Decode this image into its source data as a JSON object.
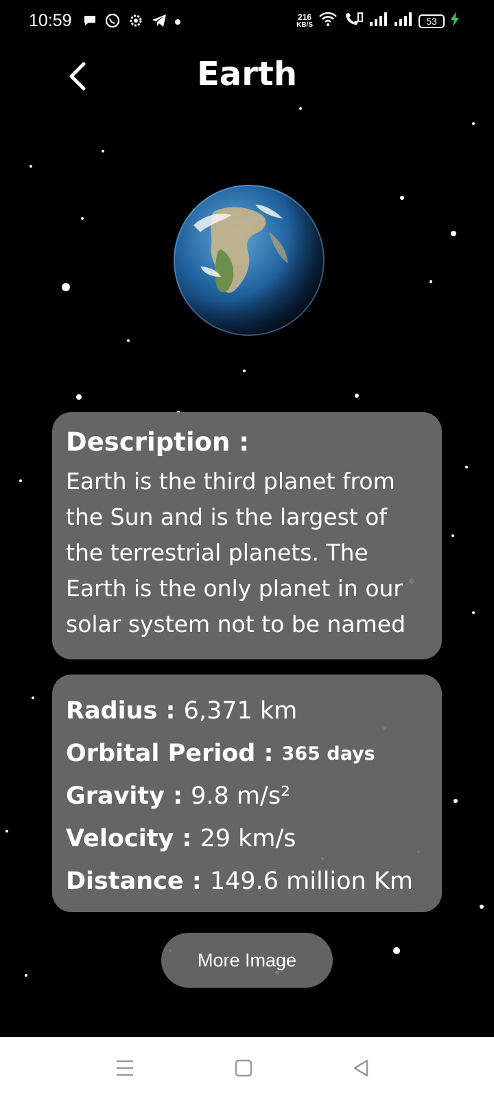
{
  "status_bar": {
    "time": "10:59",
    "net_speed_value": "216",
    "net_speed_unit": "KB/S",
    "battery": "53"
  },
  "header": {
    "title": "Earth"
  },
  "description": {
    "heading": "Description :",
    "text": "Earth is the third planet from the Sun and is the largest of the terrestrial planets. The Earth is the only planet in our solar system not to be named after a"
  },
  "stats": [
    {
      "label": "Radius :",
      "value": "6,371 km"
    },
    {
      "label": "Orbital Period :",
      "value": "365 days"
    },
    {
      "label": "Gravity :",
      "value": "9.8 m/s²"
    },
    {
      "label": "Velocity :",
      "value": "29 km/s"
    },
    {
      "label": "Distance :",
      "value": "149.6 million Km"
    }
  ],
  "actions": {
    "more_image_label": "More Image"
  },
  "colors": {
    "background": "#000000",
    "card": "#6e6e6e",
    "charging": "#37c94a"
  }
}
